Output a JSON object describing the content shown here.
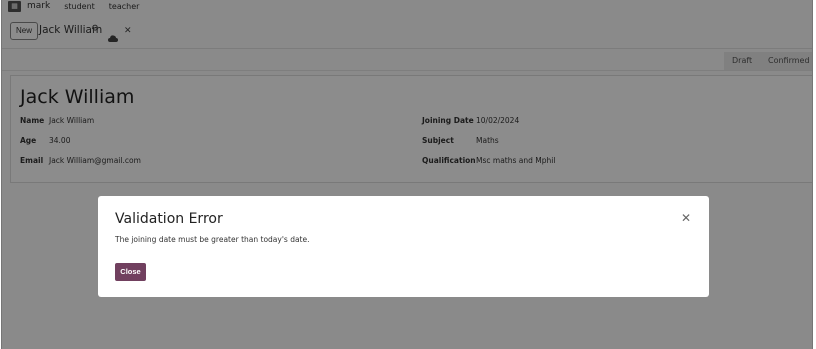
{
  "topnav": {
    "brand": "mark",
    "items": [
      "student",
      "teacher"
    ]
  },
  "control_panel": {
    "new_label": "New",
    "breadcrumb": "Jack William"
  },
  "statusbar": {
    "stages": [
      "Draft",
      "Confirmed"
    ]
  },
  "form": {
    "title": "Jack William",
    "left": [
      {
        "label": "Name",
        "value": "Jack William"
      },
      {
        "label": "Age",
        "value": "34.00"
      },
      {
        "label": "Email",
        "value": "Jack William@gmail.com"
      }
    ],
    "right": [
      {
        "label": "Joining Date",
        "value": "10/02/2024"
      },
      {
        "label": "Subject",
        "value": "Maths"
      },
      {
        "label": "Qualification",
        "value": "Msc maths and Mphil"
      }
    ]
  },
  "dialog": {
    "title": "Validation Error",
    "message": "The joining date must be greater than today's date.",
    "close_label": "Close",
    "primary_color": "#71405f"
  }
}
